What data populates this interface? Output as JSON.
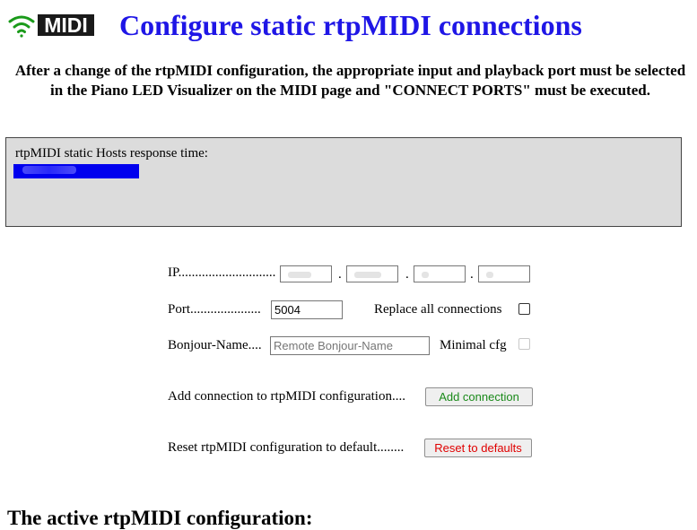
{
  "header": {
    "logo_text": "MIDI",
    "title": "Configure static rtpMIDI connections"
  },
  "notice": "After a change of the rtpMIDI configuration, the appropriate input and playback port must be selected in the Piano LED Visualizer on the MIDI page and \"CONNECT PORTS\" must be executed.",
  "status": {
    "label": "rtpMIDI static Hosts response time:"
  },
  "form": {
    "ip_label": "IP.............................",
    "ip_separator": ".",
    "port_label": "Port.....................",
    "port_value": "5004",
    "replace_all_label": "Replace all connections",
    "replace_all_checked": false,
    "bonjour_label": "Bonjour-Name....",
    "bonjour_placeholder": "Remote Bonjour-Name",
    "minimal_cfg_label": "Minimal cfg",
    "minimal_cfg_disabled": true,
    "add_label": "Add connection to rtpMIDI configuration....",
    "add_button": "Add connection",
    "reset_label": "Reset rtpMIDI configuration to default........",
    "reset_button": "Reset to defaults"
  },
  "section": {
    "active_config_title": "The active rtpMIDI configuration:"
  },
  "colors": {
    "title": "#1f16e6",
    "status_bar": "#0000ee",
    "add_button_text": "#1a8a1a",
    "reset_button_text": "#e00000",
    "logo": "#1a1a1a",
    "wifi_icon": "#1a9a1a"
  }
}
